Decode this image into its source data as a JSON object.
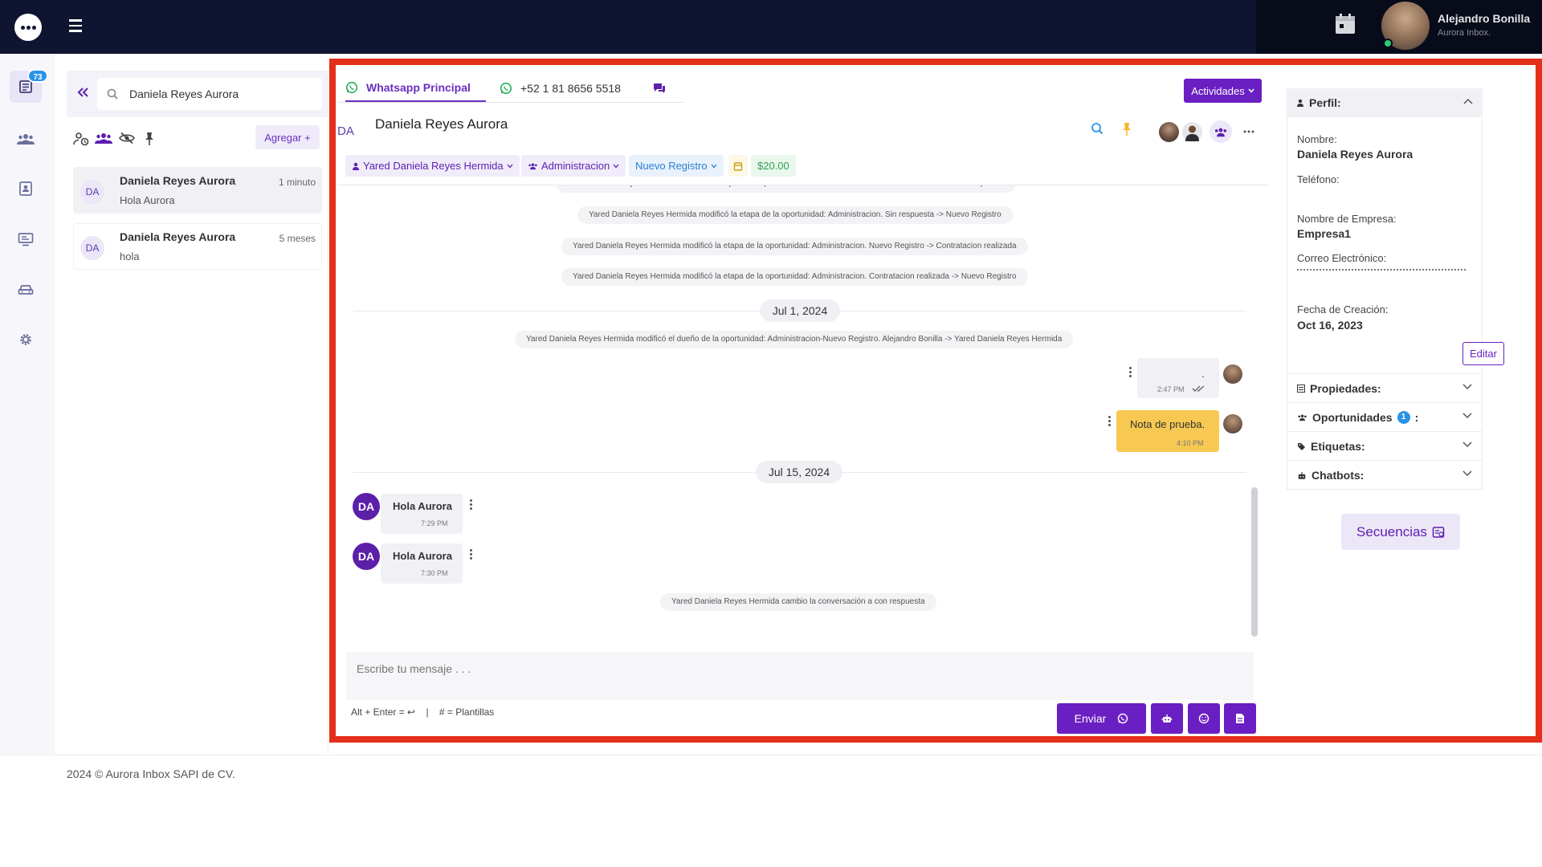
{
  "topbar": {
    "user_name": "Alejandro Bonilla",
    "user_subtitle": "Aurora Inbox."
  },
  "rail": {
    "badge": "73"
  },
  "conversations": {
    "search_value": "Daniela Reyes Aurora",
    "add_label": "Agregar +",
    "items": [
      {
        "initials": "DA",
        "name": "Daniela Reyes Aurora",
        "preview": "Hola Aurora",
        "time": "1 minuto"
      },
      {
        "initials": "DA",
        "name": "Daniela Reyes Aurora",
        "preview": "hola",
        "time": "5 meses"
      }
    ]
  },
  "chat": {
    "tabs": [
      {
        "label": "Whatsapp Principal"
      },
      {
        "label": "+52 1 81 8656 5518"
      }
    ],
    "actividades_label": "Actividades",
    "contact_initials": "DA",
    "contact_name": "Daniela Reyes Aurora",
    "tags": {
      "owner": "Yared Daniela Reyes Hermida",
      "team": "Administracion",
      "stage": "Nuevo Registro",
      "amount": "$20.00"
    },
    "system_messages": [
      "Yared Daniela Reyes Hermida modificó la etapa de la oportunidad: Administracion. Contratacion realizada -> Sin respuesta",
      "Yared Daniela Reyes Hermida modificó la etapa de la oportunidad: Administracion. Sin respuesta -> Nuevo Registro",
      "Yared Daniela Reyes Hermida modificó la etapa de la oportunidad: Administracion. Nuevo Registro -> Contratacion realizada",
      "Yared Daniela Reyes Hermida modificó la etapa de la oportunidad: Administracion. Contratacion realizada -> Nuevo Registro",
      "Yared Daniela Reyes Hermida modificó el dueño de la oportunidad: Administracion-Nuevo Registro. Alejandro Bonilla -> Yared Daniela Reyes Hermida",
      "Yared Daniela Reyes Hermida cambio la conversación a con respuesta"
    ],
    "date_1": "Jul 1, 2024",
    "date_2": "Jul 15, 2024",
    "out_1": {
      "text": ".",
      "time": "2:47 PM"
    },
    "out_2": {
      "text": "Nota de prueba.",
      "time": "4:10 PM"
    },
    "in_1": {
      "initials": "DA",
      "text": "Hola Aurora",
      "time": "7:29 PM"
    },
    "in_2": {
      "initials": "DA",
      "text": "Hola Aurora",
      "time": "7:30 PM"
    },
    "composer_placeholder": "Escribe tu mensaje . . .",
    "hint_shortcut": "Alt + Enter = ↩",
    "hint_templates": "# = Plantillas",
    "send_label": "Enviar"
  },
  "profile": {
    "title": "Perfil:",
    "name_label": "Nombre:",
    "name_value": "Daniela Reyes Aurora",
    "phone_label": "Teléfono:",
    "company_label": "Nombre de Empresa:",
    "company_value": "Empresa1",
    "email_label": "Correo Electrónico:",
    "created_label": "Fecha de Creación:",
    "created_value": "Oct 16, 2023",
    "edit_label": "Editar",
    "sections": {
      "properties": "Propiedades:",
      "opportunities": "Oportunidades",
      "opportunities_count": "1",
      "tags": "Etiquetas:",
      "chatbots": "Chatbots:"
    },
    "sequences_label": "Secuencias"
  },
  "footer": {
    "text": "2024 © Aurora Inbox SAPI de CV."
  },
  "colors": {
    "accent": "#6a1fc2",
    "topbar": "#0f1530",
    "frame": "#e3301a",
    "note": "#f7c952"
  }
}
